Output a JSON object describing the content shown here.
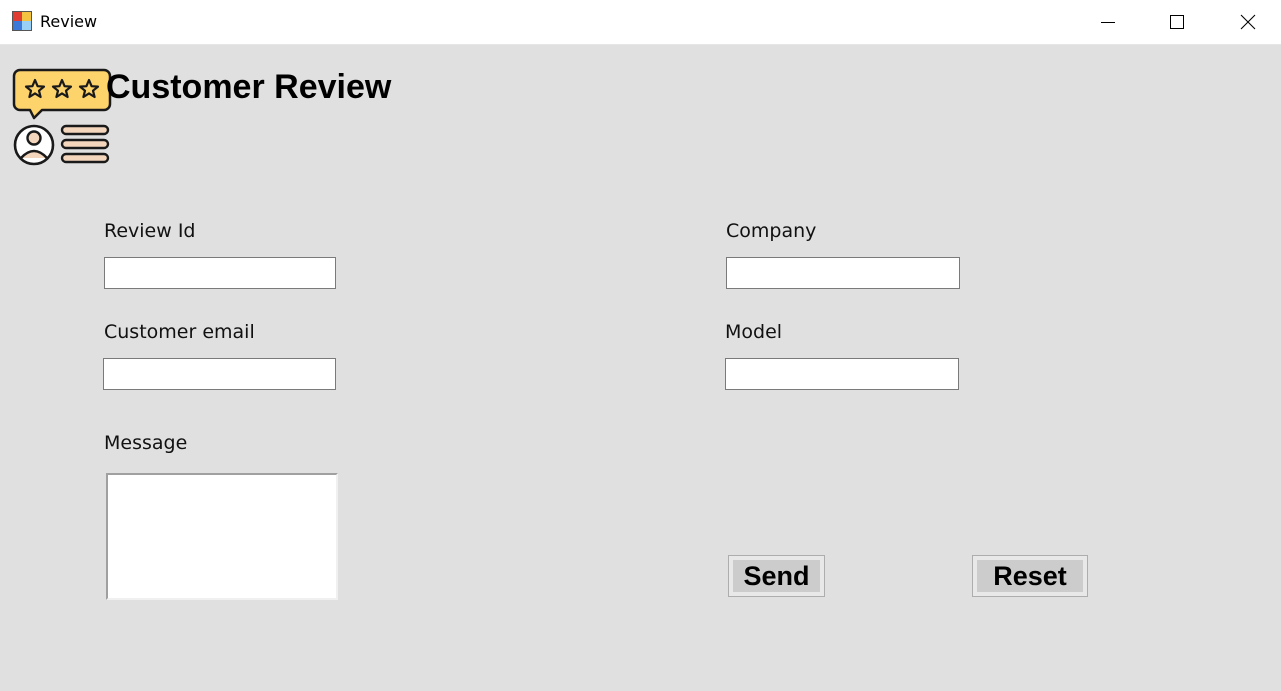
{
  "window": {
    "title": "Review",
    "icon": "winforms-app-icon",
    "controls": [
      "minimize-icon",
      "maximize-icon",
      "close-icon"
    ]
  },
  "header": {
    "title": "Customer Review",
    "logo_icon": "customer-review-stars-icon"
  },
  "form": {
    "review_id": {
      "label": "Review Id",
      "value": ""
    },
    "customer_email": {
      "label": "Customer email",
      "value": ""
    },
    "message": {
      "label": "Message",
      "value": ""
    },
    "company": {
      "label": "Company",
      "value": ""
    },
    "model": {
      "label": "Model",
      "value": ""
    }
  },
  "buttons": {
    "send": "Send",
    "reset": "Reset"
  },
  "colors": {
    "background": "#e0e0e0",
    "titlebar": "#ffffff",
    "logo_accent": "#fdd36b",
    "button_face": "#cccccc"
  }
}
